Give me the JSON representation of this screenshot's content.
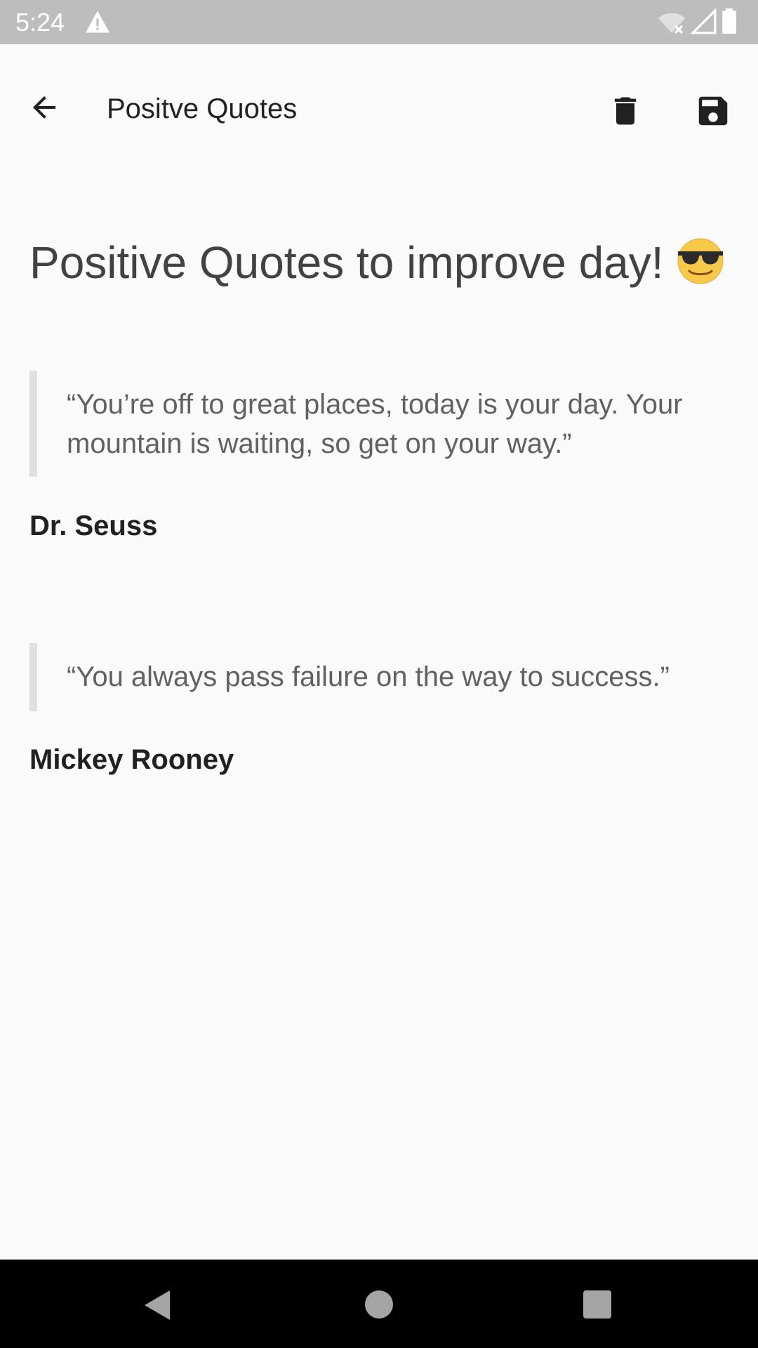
{
  "status_bar": {
    "time": "5:24",
    "icons": [
      "warning-icon",
      "wifi-off-icon",
      "cell-signal-icon",
      "battery-icon"
    ]
  },
  "app_bar": {
    "title": "Positve Quotes",
    "icons": [
      "arrow-back-icon",
      "trash-icon",
      "save-icon"
    ]
  },
  "content": {
    "heading": "Positive Quotes to improve day!",
    "heading_emoji": "smiling-face-with-sunglasses-icon",
    "quotes": [
      {
        "text": "“You’re off to great places, today is your day. Your mountain is waiting, so get on your way.”",
        "author": "Dr. Seuss"
      },
      {
        "text": "“You always pass failure on the way to success.”",
        "author": "Mickey Rooney"
      }
    ]
  },
  "nav_bar": {
    "icons": [
      "nav-back-icon",
      "nav-home-icon",
      "nav-recents-icon"
    ]
  },
  "colors": {
    "status_bar": "#bdbdbd",
    "background": "#fafafa",
    "quote_border": "#e0e0e0",
    "nav_bar": "#000000"
  }
}
